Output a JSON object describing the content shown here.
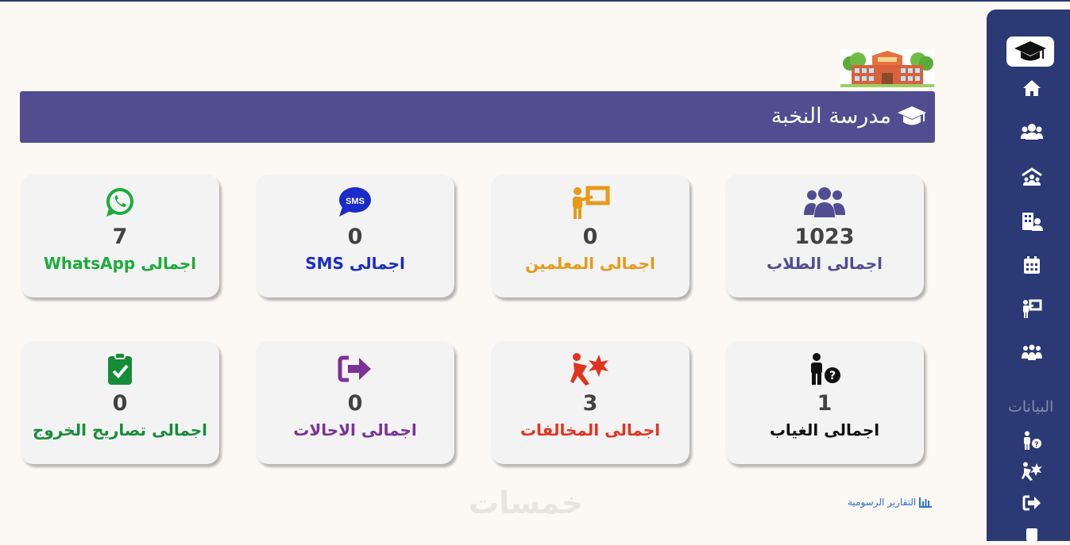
{
  "header": {
    "title": "مدرسة النخبة"
  },
  "sidebar": {
    "section_label": "البيانات"
  },
  "stats_row1": [
    {
      "value": "1023",
      "label": "اجمالى الطلاب",
      "color": "#524d91",
      "icon": "users-icon"
    },
    {
      "value": "0",
      "label": "اجمالى المعلمين",
      "color": "#e79a16",
      "icon": "teacher-icon"
    },
    {
      "value": "0",
      "label": "اجمالى SMS",
      "color": "#1b2bc9",
      "icon": "sms-icon"
    },
    {
      "value": "7",
      "label": "اجمالى WhatsApp",
      "color": "#1cac3a",
      "icon": "whatsapp-icon"
    }
  ],
  "stats_row2": [
    {
      "value": "1",
      "label": "اجمالى الغياب",
      "color": "#111111",
      "icon": "absence-icon"
    },
    {
      "value": "3",
      "label": "اجمالى المخالفات",
      "color": "#e0341e",
      "icon": "violation-icon"
    },
    {
      "value": "0",
      "label": "اجمالى الاحالات",
      "color": "#7b3196",
      "icon": "sign-out-icon"
    },
    {
      "value": "0",
      "label": "اجمالى تصاريح الخروج",
      "color": "#178c38",
      "icon": "clipboard-check-icon"
    }
  ],
  "footer": {
    "reports_link": "التقارير الرسومية",
    "watermark": "خمسات"
  }
}
